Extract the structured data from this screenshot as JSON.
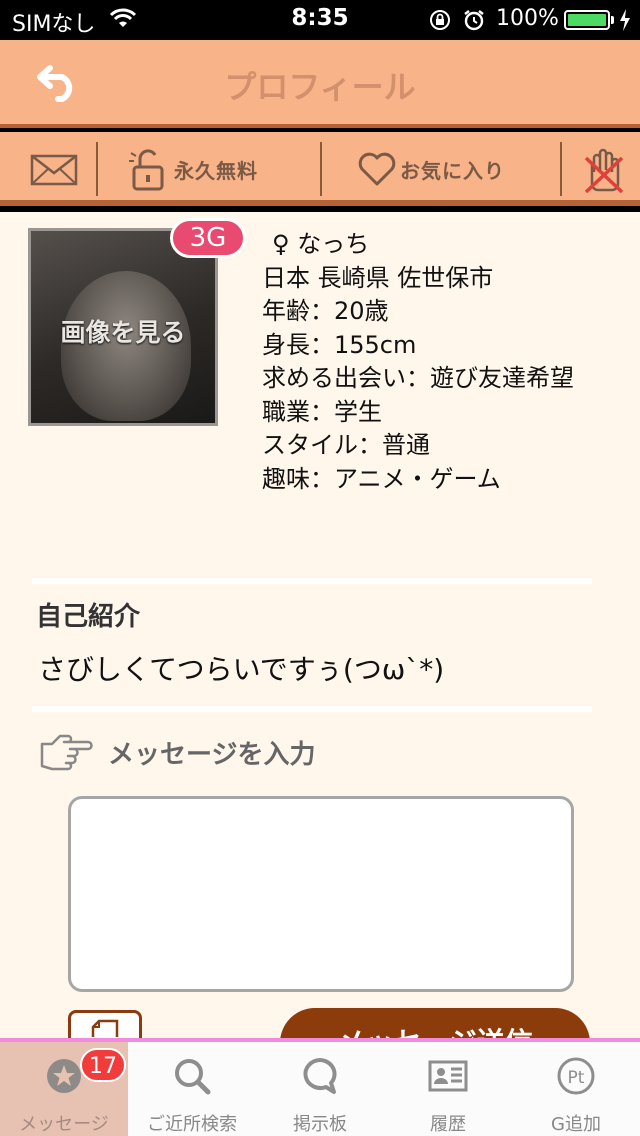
{
  "status_bar": {
    "carrier": "SIMなし",
    "time": "8:35",
    "battery_percent": "100%"
  },
  "navbar": {
    "title": "プロフィール"
  },
  "toolbar": {
    "free_label": "永久無料",
    "favorite_label": "お気に入り"
  },
  "profile": {
    "photo_label": "画像を見る",
    "badge": "3G",
    "name_line": "♀ なっち",
    "location": "日本 長崎県 佐世保市",
    "age": "年齢：20歳",
    "height": "身長：155cm",
    "seeking": "求める出会い：遊び友達希望",
    "occupation": "職業：学生",
    "style": "スタイル：普通",
    "hobby": "趣味：アニメ・ゲーム"
  },
  "intro": {
    "heading": "自己紹介",
    "text": "さびしくてつらいですぅ(つω`*)"
  },
  "message": {
    "label": "メッセージを入力",
    "value": "",
    "send_label": "メッセージ送信"
  },
  "tabs": [
    {
      "label": "メッセージ",
      "icon": "star-icon",
      "badge": "17",
      "active": true
    },
    {
      "label": "ご近所検索",
      "icon": "search-icon"
    },
    {
      "label": "掲示板",
      "icon": "speech-bubble-icon"
    },
    {
      "label": "履歴",
      "icon": "id-card-icon"
    },
    {
      "label": "G追加",
      "icon": "points-icon"
    }
  ],
  "colors": {
    "header": "#f8b389",
    "header_border": "#b66238",
    "content_bg": "#fff6ec",
    "accent_brown": "#8c3c0a",
    "badge_pink": "#e84a70",
    "tab_active": "#e7c2b2"
  }
}
